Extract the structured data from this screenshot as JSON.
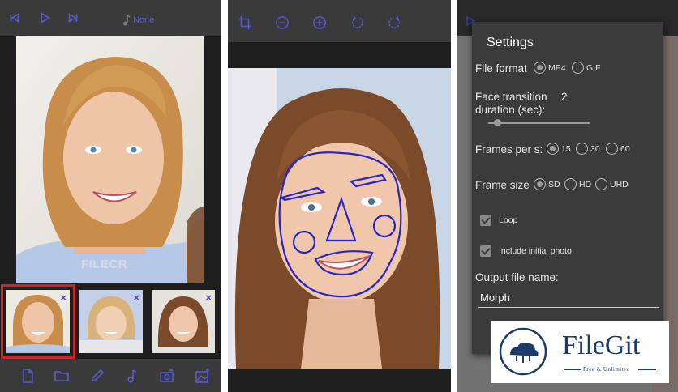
{
  "panel1": {
    "music_label": "None",
    "watermark": "FILECR",
    "thumbnails": [
      {
        "selected": true,
        "close": "×"
      },
      {
        "selected": false,
        "close": "×"
      },
      {
        "selected": false,
        "close": "×"
      }
    ],
    "icons": {
      "top": [
        "skip-back-icon",
        "play-icon",
        "skip-forward-icon",
        "music-note-icon"
      ],
      "bottom": [
        "new-file-icon",
        "folder-icon",
        "pencil-icon",
        "music-note-icon",
        "add-camera-icon",
        "add-image-icon"
      ]
    }
  },
  "panel2": {
    "icons": [
      "crop-icon",
      "zoom-out-icon",
      "zoom-in-icon",
      "rotate-left-icon",
      "rotate-right-icon"
    ]
  },
  "settings": {
    "title": "Settings",
    "file_format_label": "File format",
    "file_format_options": [
      "MP4",
      "GIF"
    ],
    "file_format_selected": "MP4",
    "transition_label": "Face transition duration (sec):",
    "transition_value": "2",
    "fps_label": "Frames per s:",
    "fps_options": [
      "15",
      "30",
      "60"
    ],
    "fps_selected": "15",
    "frame_size_label": "Frame size",
    "frame_size_options": [
      "SD",
      "HD",
      "UHD"
    ],
    "frame_size_selected": "SD",
    "loop_label": "Loop",
    "loop_checked": true,
    "initial_photo_label": "Include initial photo",
    "initial_photo_checked": true,
    "output_label": "Output file name:",
    "output_value": "Morph"
  },
  "badge": {
    "name": "FileGit",
    "tagline": "Free & Unlimited"
  },
  "colors": {
    "toolbar_icon": "#5b57d6",
    "selected_outline": "#c62828",
    "face_outline": "#2626c8",
    "badge_text": "#1c3b6b"
  }
}
